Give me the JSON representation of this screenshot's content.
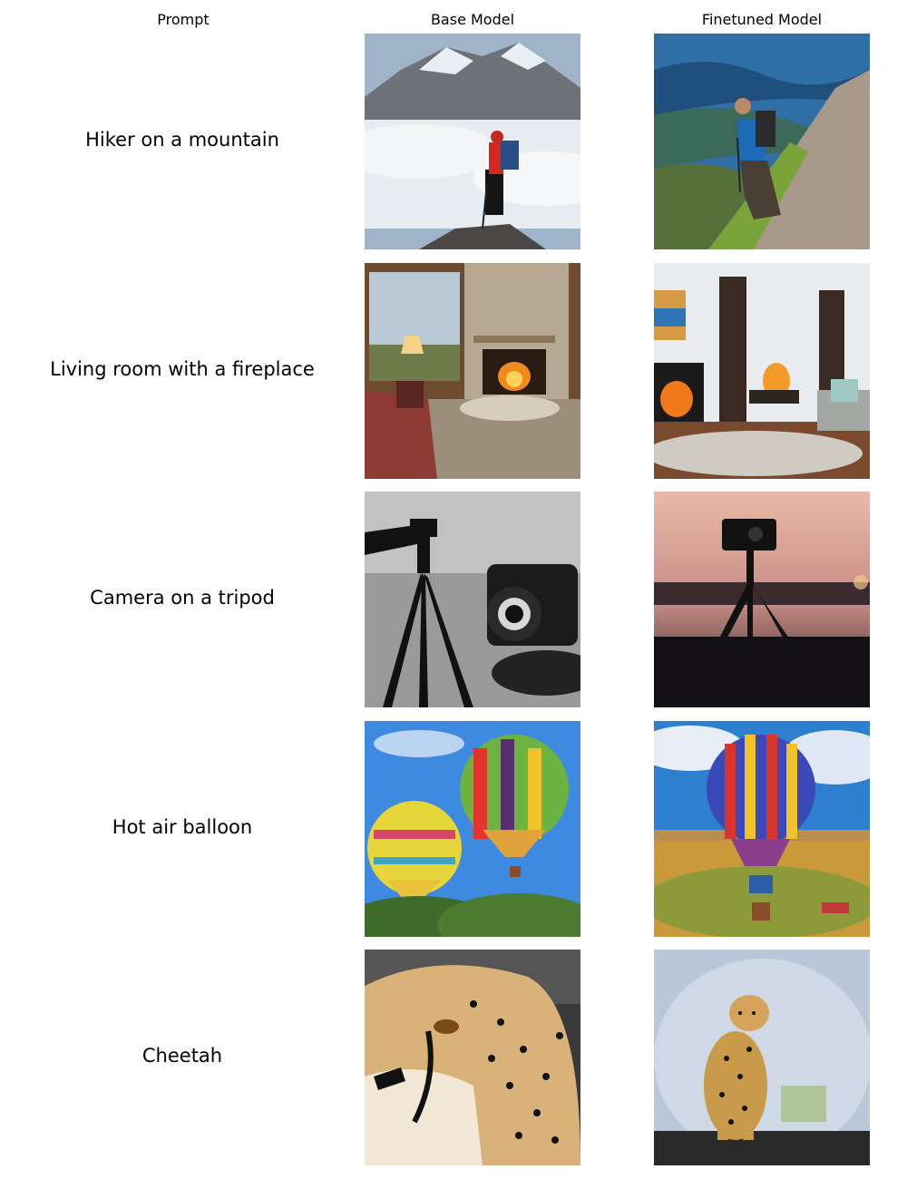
{
  "headers": {
    "prompt": "Prompt",
    "base": "Base Model",
    "finetuned": "Finetuned Model"
  },
  "rows": [
    {
      "prompt": "Hiker on a mountain",
      "base_image": "hiker-mountain-base-image",
      "finetuned_image": "hiker-mountain-finetuned-image"
    },
    {
      "prompt": "Living room with a fireplace",
      "base_image": "living-room-base-image",
      "finetuned_image": "living-room-finetuned-image"
    },
    {
      "prompt": "Camera on a tripod",
      "base_image": "camera-tripod-base-image",
      "finetuned_image": "camera-tripod-finetuned-image"
    },
    {
      "prompt": "Hot air balloon",
      "base_image": "hot-air-balloon-base-image",
      "finetuned_image": "hot-air-balloon-finetuned-image"
    },
    {
      "prompt": "Cheetah",
      "base_image": "cheetah-base-image",
      "finetuned_image": "cheetah-finetuned-image"
    }
  ]
}
